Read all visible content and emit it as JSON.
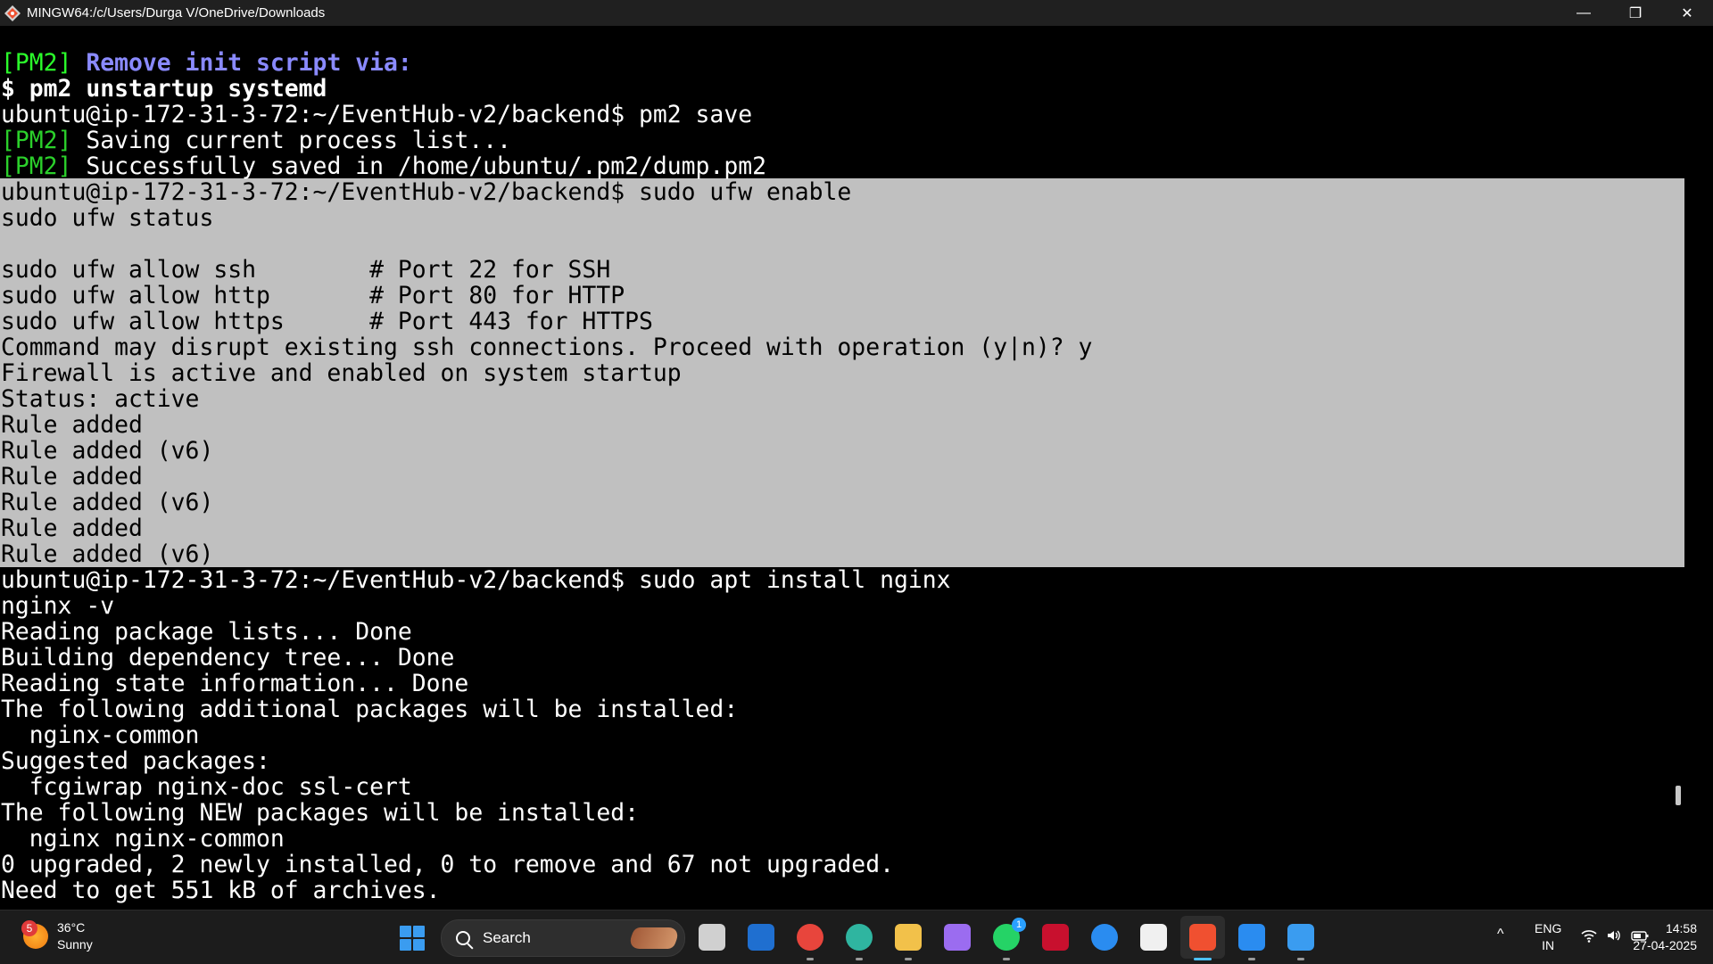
{
  "window": {
    "title": "MINGW64:/c/Users/Durga V/OneDrive/Downloads",
    "controls": {
      "minimize": "—",
      "restore": "❐",
      "close": "✕"
    }
  },
  "terminal": {
    "pre_lines": [
      {
        "segments": [
          {
            "text": "[PM2]",
            "cls": "pm2-bright"
          },
          {
            "text": " Remove init script via:",
            "cls": "blue-bold"
          }
        ]
      },
      {
        "segments": [
          {
            "text": "$ pm2 unstartup systemd",
            "cls": "white-bold"
          }
        ]
      },
      {
        "segments": [
          {
            "text": "ubuntu@ip-172-31-3-72:~/EventHub-v2/backend$ pm2 save",
            "cls": ""
          }
        ]
      },
      {
        "segments": [
          {
            "text": "[PM2]",
            "cls": "pm2-dim"
          },
          {
            "text": " Saving current process list...",
            "cls": ""
          }
        ]
      },
      {
        "segments": [
          {
            "text": "[PM2]",
            "cls": "pm2-dim"
          },
          {
            "text": " Successfully saved in /home/ubuntu/.pm2/dump.pm2",
            "cls": ""
          }
        ]
      }
    ],
    "selected_lines": [
      "ubuntu@ip-172-31-3-72:~/EventHub-v2/backend$ sudo ufw enable",
      "sudo ufw status",
      "",
      "sudo ufw allow ssh        # Port 22 for SSH",
      "sudo ufw allow http       # Port 80 for HTTP",
      "sudo ufw allow https      # Port 443 for HTTPS",
      "Command may disrupt existing ssh connections. Proceed with operation (y|n)? y",
      "Firewall is active and enabled on system startup",
      "Status: active",
      "Rule added",
      "Rule added (v6)",
      "Rule added",
      "Rule added (v6)",
      "Rule added",
      "Rule added (v6)"
    ],
    "post_lines": [
      "ubuntu@ip-172-31-3-72:~/EventHub-v2/backend$ sudo apt install nginx",
      "nginx -v",
      "Reading package lists... Done",
      "Building dependency tree... Done",
      "Reading state information... Done",
      "The following additional packages will be installed:",
      "  nginx-common",
      "Suggested packages:",
      "  fcgiwrap nginx-doc ssl-cert",
      "The following NEW packages will be installed:",
      "  nginx nginx-common",
      "0 upgraded, 2 newly installed, 0 to remove and 67 not upgraded.",
      "Need to get 551 kB of archives."
    ]
  },
  "taskbar": {
    "weather": {
      "temp": "36°C",
      "condition": "Sunny",
      "badge": "5"
    },
    "search_label": "Search",
    "apps": [
      {
        "name": "task-view-icon",
        "color": "#d0d0d0",
        "running": false
      },
      {
        "name": "mobile-app-icon",
        "color": "#1f6fd0",
        "running": false
      },
      {
        "name": "chrome-icon",
        "color": "#e8453c",
        "running": true
      },
      {
        "name": "edge-icon",
        "color": "#2fb5a0",
        "running": true
      },
      {
        "name": "file-explorer-icon",
        "color": "#f2c14a",
        "running": true
      },
      {
        "name": "copilot-icon",
        "color": "#9b6cf0",
        "running": false
      },
      {
        "name": "whatsapp-icon",
        "color": "#25d366",
        "running": true,
        "badge": "1"
      },
      {
        "name": "mcafee-icon",
        "color": "#c8102e",
        "running": false
      },
      {
        "name": "help-icon",
        "color": "#2a8cf0",
        "running": false
      },
      {
        "name": "microsoft-store-icon",
        "color": "#f0f0f0",
        "running": false
      },
      {
        "name": "git-bash-icon",
        "color": "#f05030",
        "running": true,
        "active": true
      },
      {
        "name": "vscode-icon",
        "color": "#2a8cf0",
        "running": true
      },
      {
        "name": "paint-icon",
        "color": "#3a9cf0",
        "running": true
      }
    ],
    "tray": {
      "chevron": "^",
      "lang_line1": "ENG",
      "lang_line2": "IN",
      "time": "14:58",
      "date": "27-04-2025"
    }
  }
}
